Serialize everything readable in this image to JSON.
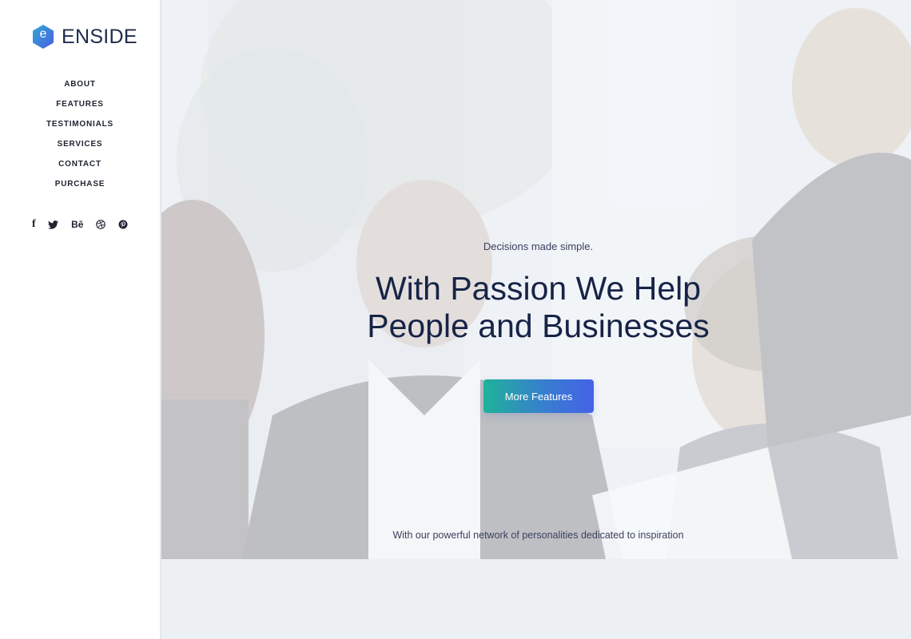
{
  "brand": {
    "logo_letter": "e",
    "name": "ENSIDE",
    "accent_colors": [
      "#2fa7d6",
      "#4a5ee0"
    ]
  },
  "nav": {
    "items": [
      {
        "label": "ABOUT"
      },
      {
        "label": "FEATURES"
      },
      {
        "label": "TESTIMONIALS"
      },
      {
        "label": "SERVICES"
      },
      {
        "label": "CONTACT"
      },
      {
        "label": "PURCHASE"
      }
    ]
  },
  "social": {
    "icons": [
      "facebook-icon",
      "twitter-icon",
      "behance-icon",
      "dribbble-icon",
      "pinterest-icon"
    ],
    "facebook_glyph": "f",
    "behance_glyph": "Bē"
  },
  "hero": {
    "eyebrow": "Decisions made simple.",
    "headline_line1": "With Passion We Help",
    "headline_line2": "People and Businesses",
    "cta_label": "More Features",
    "tagline": "With our powerful network of personalities dedicated to inspiration",
    "cta_gradient": [
      "#1fb29a",
      "#4462e5"
    ],
    "text_color": "#172347"
  }
}
